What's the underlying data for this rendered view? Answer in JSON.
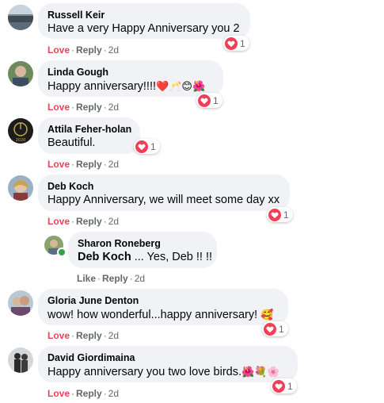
{
  "comments": [
    {
      "author": "Russell Keir",
      "text": "Have a very Happy Anniversary you 2",
      "reaction_count": "1",
      "action": "Love",
      "reply": "Reply",
      "time": "2d"
    },
    {
      "author": "Linda Gough",
      "text": "Happy anniversary!!!!",
      "emojis": "❤️🥂😊🌺",
      "reaction_count": "1",
      "action": "Love",
      "reply": "Reply",
      "time": "2d"
    },
    {
      "author": "Attila Feher-holan",
      "text": "Beautiful.",
      "reaction_count": "1",
      "action": "Love",
      "reply": "Reply",
      "time": "2d"
    },
    {
      "author": "Deb Koch",
      "text": "Happy Anniversary, we will meet some day xx",
      "reaction_count": "1",
      "action": "Love",
      "reply": "Reply",
      "time": "2d"
    },
    {
      "author": "Sharon Roneberg",
      "mention": "Deb Koch",
      "text": " ... Yes, Deb !! !!",
      "action": "Like",
      "reply": "Reply",
      "time": "2d"
    },
    {
      "author": "Gloria June Denton",
      "text": "wow! how wonderful...happy anniversary!",
      "emojis": "🥰",
      "reaction_count": "1",
      "action": "Love",
      "reply": "Reply",
      "time": "2d"
    },
    {
      "author": "David Giordimaina",
      "text": "Happy anniversary you two love birds.",
      "emojis": "🌺💐🌸",
      "reaction_count": "1",
      "action": "Love",
      "reply": "Reply",
      "time": "2d"
    }
  ],
  "icons": {
    "reaction": "heart-icon",
    "online": "online-dot"
  },
  "colors": {
    "love": "#f33e58",
    "bubble": "#f0f2f5",
    "muted": "#65676b",
    "online": "#31a24c"
  }
}
